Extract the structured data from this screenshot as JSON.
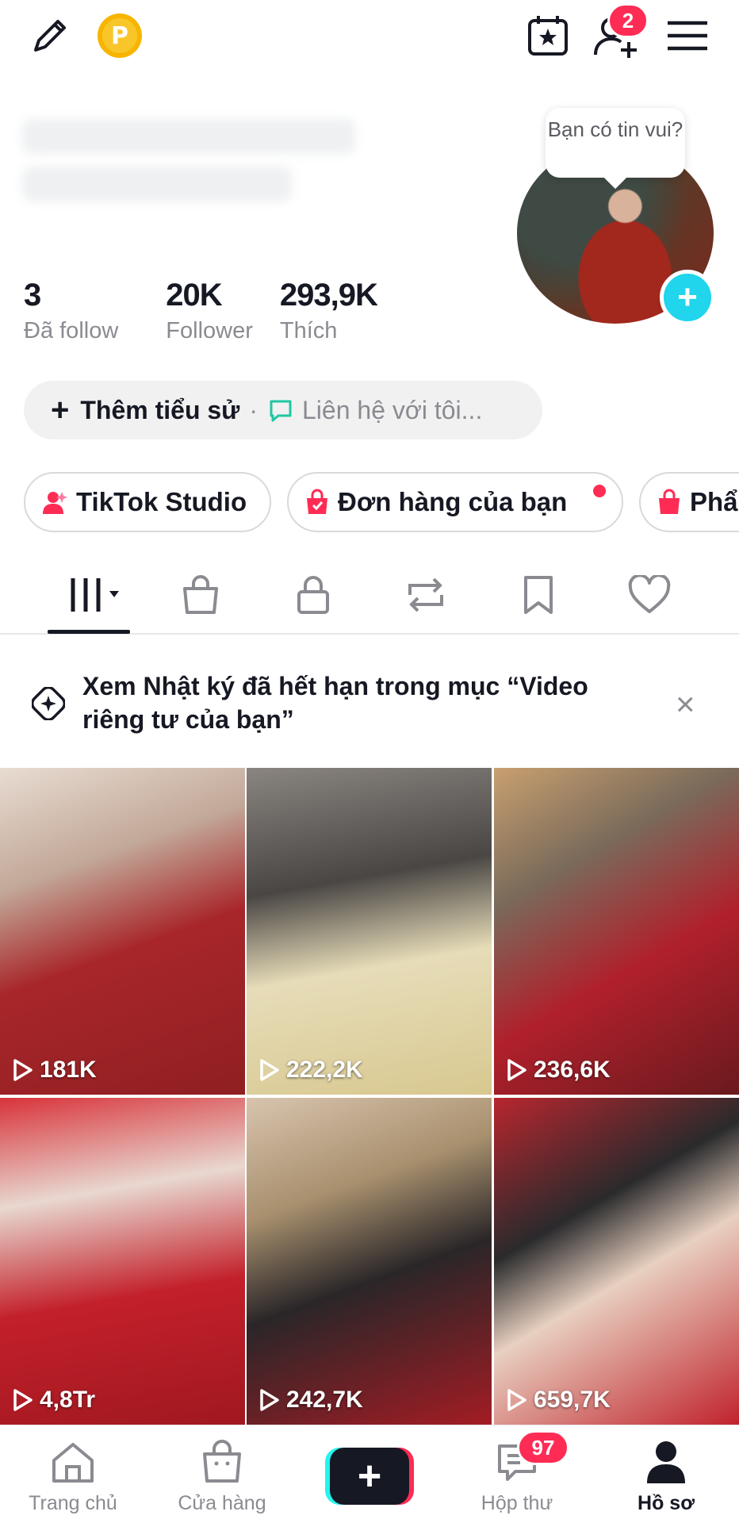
{
  "header": {
    "coin_letter": "P",
    "friend_badge": "2"
  },
  "avatar_bubble": "Bạn có tin vui?",
  "stats": [
    {
      "value": "3",
      "label": "Đã follow"
    },
    {
      "value": "20K",
      "label": "Follower"
    },
    {
      "value": "293,9K",
      "label": "Thích"
    }
  ],
  "bio": {
    "add_label": "Thêm tiểu sử",
    "separator": "·",
    "contact_label": "Liên hệ với tôi..."
  },
  "chips": [
    {
      "label": "TikTok Studio"
    },
    {
      "label": "Đơn hàng của bạn"
    },
    {
      "label": "Phẩ"
    }
  ],
  "notice": {
    "text": "Xem Nhật ký đã hết hạn trong mục “Video riêng tư của bạn”",
    "close": "×"
  },
  "videos": [
    {
      "views": "181K"
    },
    {
      "views": "222,2K"
    },
    {
      "views": "236,6K"
    },
    {
      "views": "4,8Tr"
    },
    {
      "views": "242,7K"
    },
    {
      "views": "659,7K"
    }
  ],
  "nav": {
    "home": "Trang chủ",
    "shop": "Cửa hàng",
    "create": "+",
    "inbox": "Hộp thư",
    "inbox_badge": "97",
    "profile": "Hồ sơ"
  },
  "colors": {
    "accent": "#fe2c55",
    "teal": "#25f4ee",
    "avatar_add": "#20d5ec",
    "coin": "#f7b500"
  }
}
